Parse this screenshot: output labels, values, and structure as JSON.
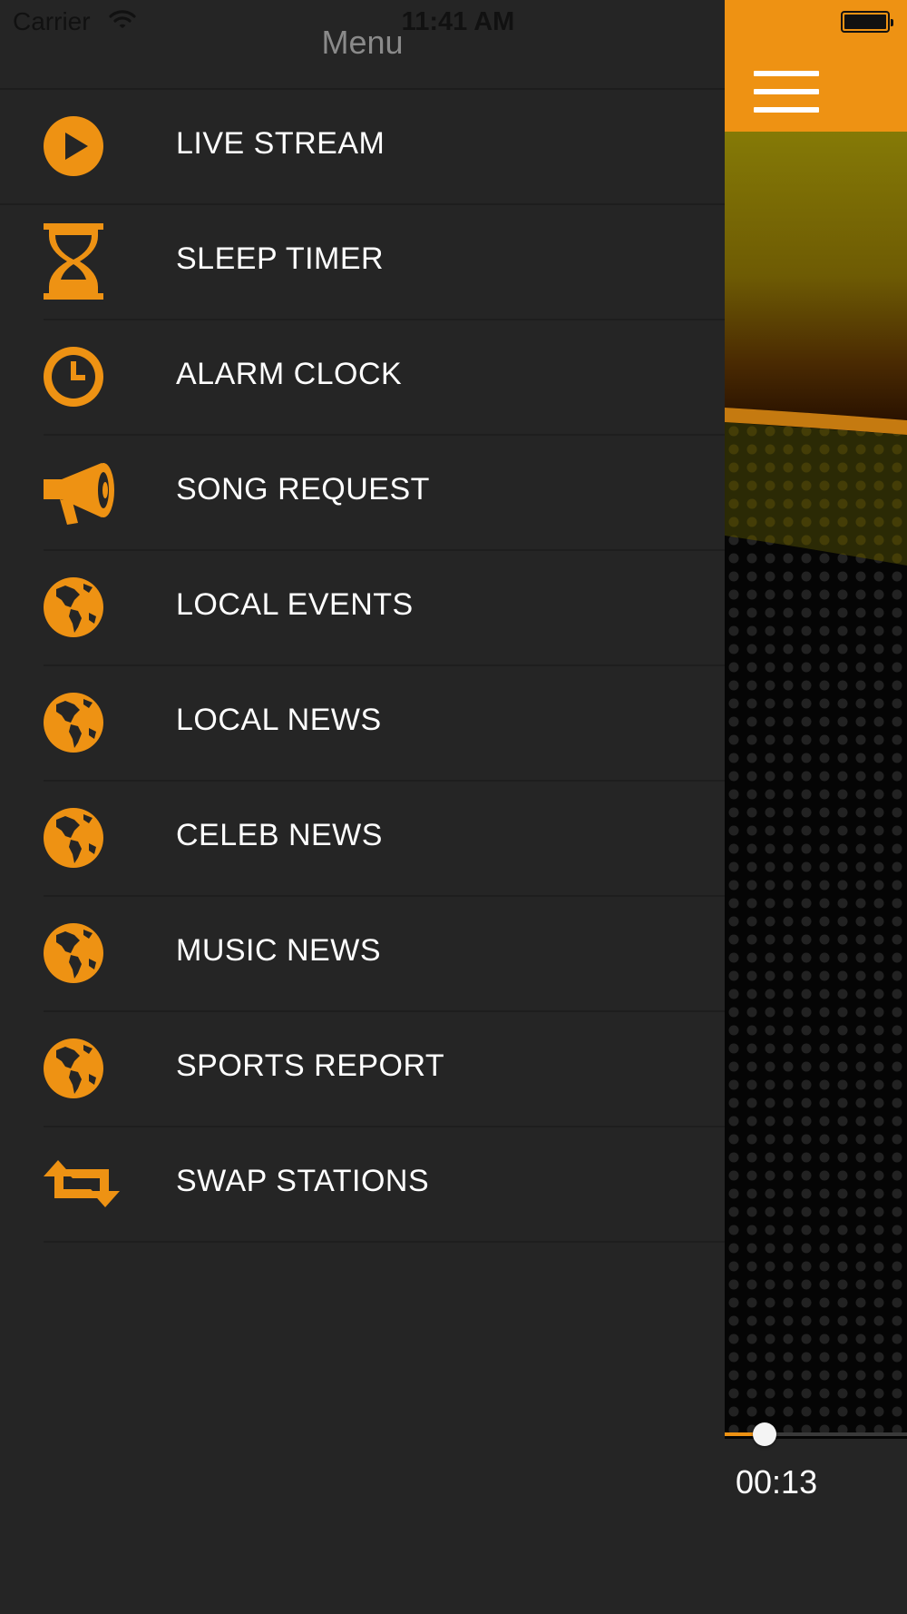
{
  "status_bar": {
    "carrier": "Carrier",
    "time": "11:41 AM"
  },
  "menu": {
    "title": "Menu",
    "items": [
      {
        "label": "LIVE STREAM",
        "icon": "play-icon"
      },
      {
        "label": "SLEEP TIMER",
        "icon": "hourglass-icon"
      },
      {
        "label": "ALARM CLOCK",
        "icon": "clock-icon"
      },
      {
        "label": "SONG REQUEST",
        "icon": "megaphone-icon"
      },
      {
        "label": "LOCAL EVENTS",
        "icon": "globe-icon"
      },
      {
        "label": "LOCAL NEWS",
        "icon": "globe-icon"
      },
      {
        "label": "CELEB NEWS",
        "icon": "globe-icon"
      },
      {
        "label": "MUSIC NEWS",
        "icon": "globe-icon"
      },
      {
        "label": "SPORTS REPORT",
        "icon": "globe-icon"
      },
      {
        "label": "SWAP STATIONS",
        "icon": "swap-icon"
      }
    ]
  },
  "player": {
    "elapsed": "00:13",
    "progress_fraction": 0.22
  },
  "colors": {
    "accent": "#ee9213",
    "background": "#252525",
    "text": "#ffffff",
    "menu_title": "#8a8a8a"
  }
}
